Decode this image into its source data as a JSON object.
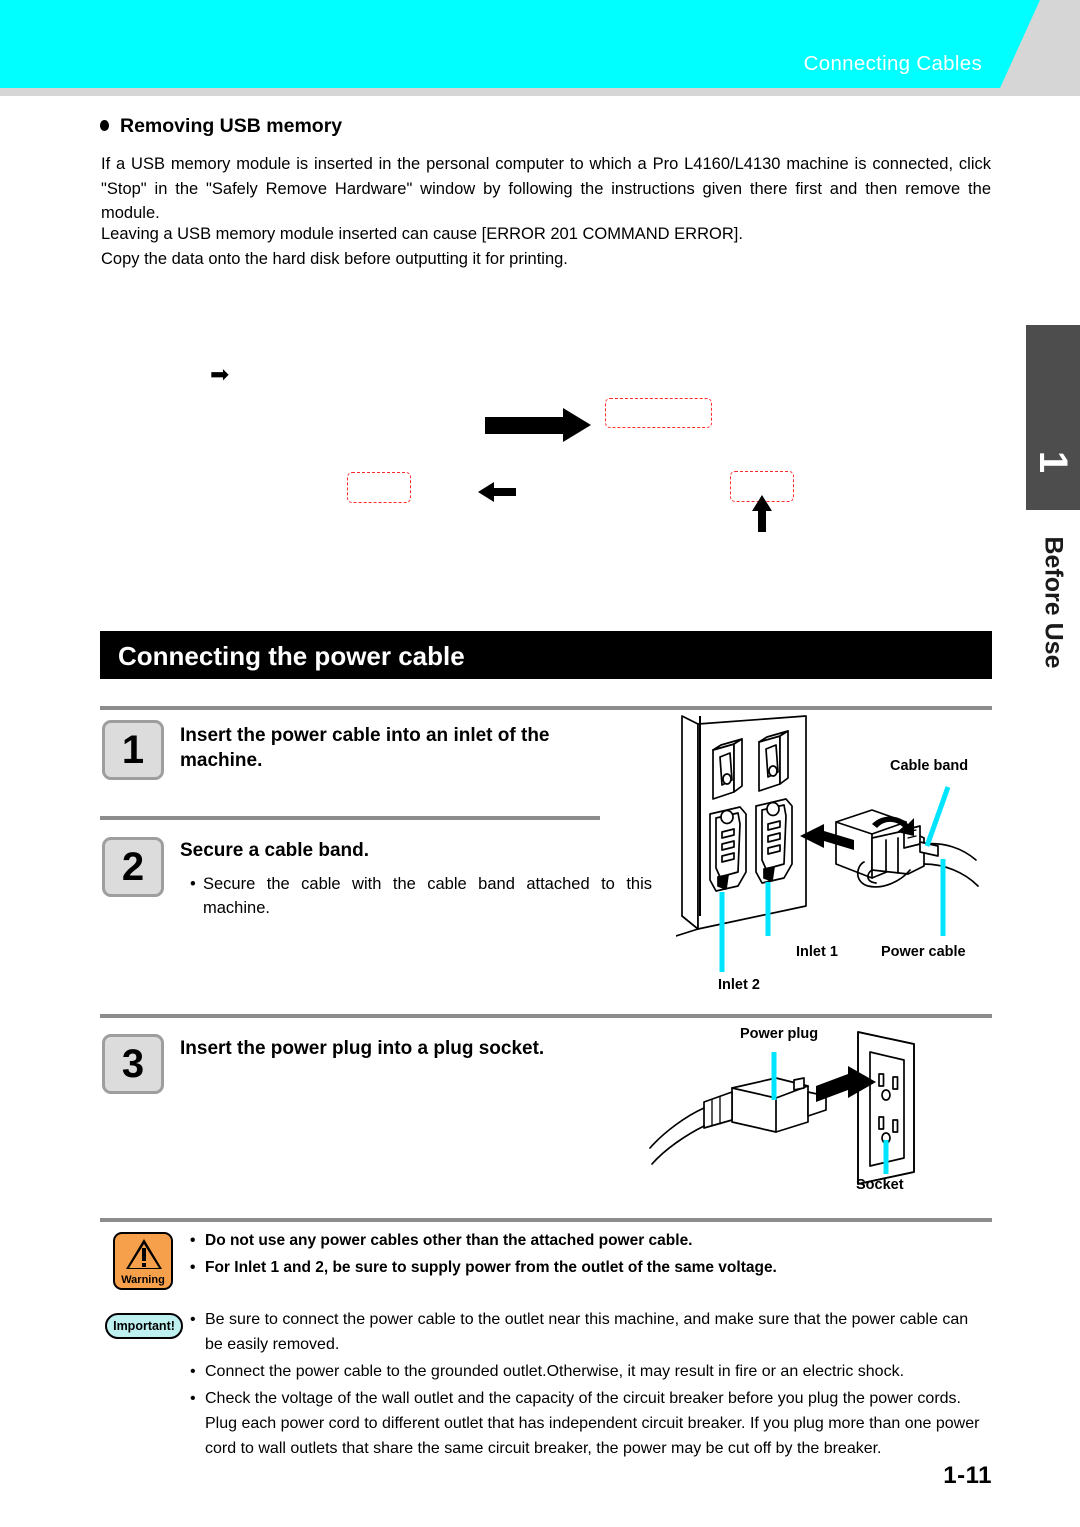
{
  "header": {
    "title": "Connecting Cables",
    "banner_color": "#00ffff",
    "band_color": "#d6d6d6"
  },
  "side_tab": {
    "number": "1",
    "label": "Before Use",
    "color": "#4d4d4d"
  },
  "section": {
    "heading": "Removing USB memory",
    "paragraph": "If a USB memory module is inserted in the personal computer to which a Pro L4160/L4130 machine is connected, click \"Stop\" in the \"Safely Remove Hardware\" window by following the instructions given there first and then remove the module.",
    "lines": [
      "Leaving a USB memory module inserted can cause [ERROR 201 COMMAND ERROR].",
      "Copy the data onto the hard disk before outputting it for printing."
    ]
  },
  "figure": {
    "arrow_small": "➡",
    "callout_color": "#ff2b2b",
    "callouts": [
      "",
      "",
      ""
    ]
  },
  "power_section": {
    "bar_title": "Connecting the power cable",
    "steps": [
      {
        "number": "1",
        "title": "Insert the power cable into an inlet of the machine.",
        "bullets": []
      },
      {
        "number": "2",
        "title": "Secure a cable band.",
        "bullets": [
          "Secure the cable with the cable band attached to this machine."
        ]
      },
      {
        "number": "3",
        "title": "Insert the power plug into a plug socket.",
        "bullets": []
      }
    ]
  },
  "illustrations": {
    "inlets": {
      "labels": {
        "cable_band": "Cable band",
        "inlet_1": "Inlet 1",
        "inlet_2": "Inlet 2",
        "power_cable": "Power cable"
      },
      "leader_color": "#00e5ff"
    },
    "socket": {
      "labels": {
        "power_plug": "Power plug",
        "socket": "Socket"
      },
      "leader_color": "#00e5ff"
    }
  },
  "notices": {
    "warning": {
      "badge_label": "Warning",
      "badge_color": "#f7a04b",
      "items": [
        "Do not use any power cables other than the attached power cable.",
        "For Inlet 1 and 2, be sure to supply power from the outlet of the same voltage."
      ]
    },
    "important": {
      "badge_label": "Important!",
      "badge_color": "#bff0f0",
      "items": [
        "Be sure to connect the power cable to the outlet near this machine, and make sure that the power cable can be easily removed.",
        "Connect the power cable to the grounded outlet.Otherwise, it may result in fire or an electric shock.",
        "Check the voltage of the wall outlet and the capacity of the circuit breaker before you plug the power cords. Plug each power cord to different outlet that has independent circuit breaker. If you plug more than one power cord to wall outlets that share the same circuit breaker, the power may be cut off by the breaker."
      ]
    }
  },
  "footer": {
    "page_number": "1-11"
  }
}
